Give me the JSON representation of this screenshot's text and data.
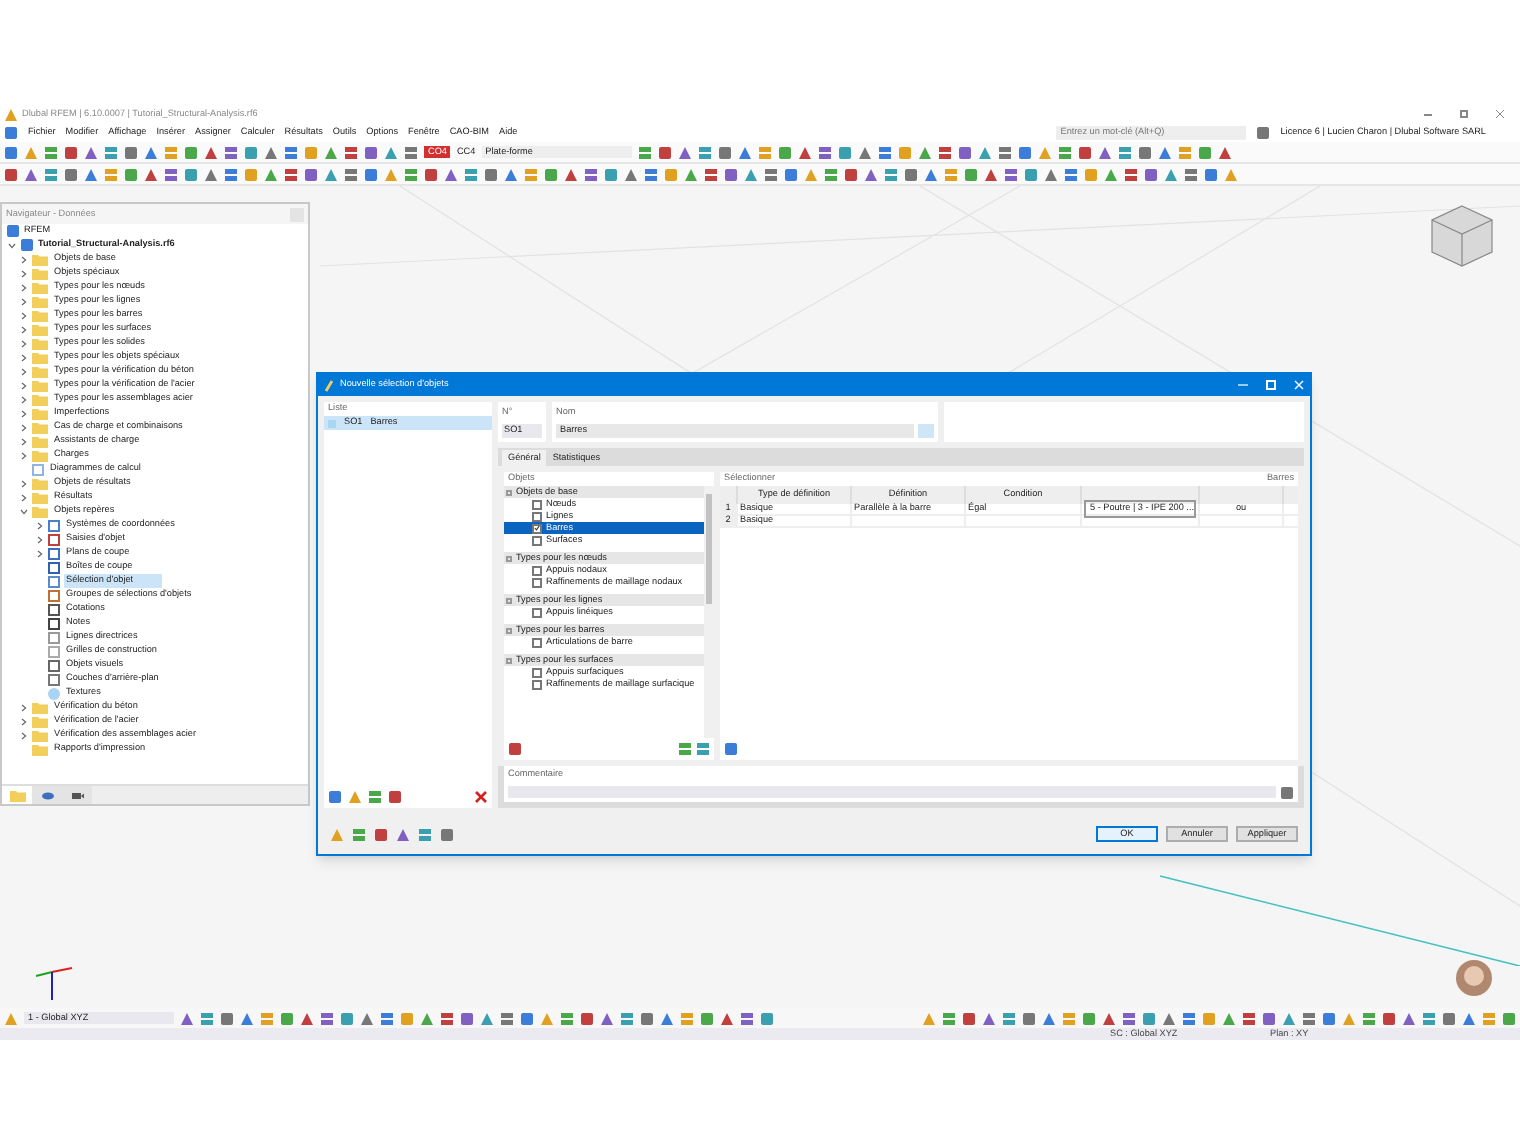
{
  "window": {
    "title": "Dlubal RFEM | 6.10.0007 | Tutorial_Structural-Analysis.rf6"
  },
  "menu": [
    "Fichier",
    "Modifier",
    "Affichage",
    "Insérer",
    "Assigner",
    "Calculer",
    "Résultats",
    "Outils",
    "Options",
    "Fenêtre",
    "CAO-BIM",
    "Aide"
  ],
  "toolbar": {
    "load_badge": "CO4",
    "load_case": "CC4",
    "design_situation": "Plate-forme",
    "search": {
      "placeholder": "Entrez un mot-clé (Alt+Q)"
    },
    "license": "Licence 6 | Lucien Charon | Dlubal Software SARL"
  },
  "navigator": {
    "title": "Navigateur - Données",
    "root": "RFEM",
    "file": "Tutorial_Structural-Analysis.rf6",
    "items": [
      {
        "label": "Objets de base",
        "kind": "folder",
        "expanded": false,
        "selected": false
      },
      {
        "label": "Objets spéciaux",
        "kind": "folder",
        "expanded": false,
        "selected": false
      },
      {
        "label": "Types pour les nœuds",
        "kind": "folder",
        "expanded": false,
        "selected": false
      },
      {
        "label": "Types pour les lignes",
        "kind": "folder",
        "expanded": false,
        "selected": false
      },
      {
        "label": "Types pour les barres",
        "kind": "folder",
        "expanded": false,
        "selected": false
      },
      {
        "label": "Types pour les surfaces",
        "kind": "folder",
        "expanded": false,
        "selected": false
      },
      {
        "label": "Types pour les solides",
        "kind": "folder",
        "expanded": false,
        "selected": false
      },
      {
        "label": "Types pour les objets spéciaux",
        "kind": "folder",
        "expanded": false,
        "selected": false
      },
      {
        "label": "Types pour la vérification du béton",
        "kind": "folder",
        "expanded": false,
        "selected": false
      },
      {
        "label": "Types pour la vérification de l'acier",
        "kind": "folder",
        "expanded": false,
        "selected": false
      },
      {
        "label": "Types pour les assemblages acier",
        "kind": "folder",
        "expanded": false,
        "selected": false
      },
      {
        "label": "Imperfections",
        "kind": "folder",
        "expanded": false,
        "selected": false
      },
      {
        "label": "Cas de charge et combinaisons",
        "kind": "folder",
        "expanded": false,
        "selected": false
      },
      {
        "label": "Assistants de charge",
        "kind": "folder",
        "expanded": false,
        "selected": false
      },
      {
        "label": "Charges",
        "kind": "folder",
        "expanded": false,
        "selected": false
      },
      {
        "label": "Diagrammes de calcul",
        "kind": "chart",
        "selected": false
      },
      {
        "label": "Objets de résultats",
        "kind": "folder",
        "expanded": false,
        "selected": false
      },
      {
        "label": "Résultats",
        "kind": "folder",
        "expanded": false,
        "selected": false
      },
      {
        "label": "Objets repères",
        "kind": "folder",
        "expanded": true,
        "selected": false,
        "children": [
          {
            "label": "Systèmes de coordonnées",
            "kind": "axes",
            "expanded": false,
            "selected": false
          },
          {
            "label": "Saisies d'objet",
            "kind": "magnet",
            "expanded": false,
            "selected": false
          },
          {
            "label": "Plans de coupe",
            "kind": "plane",
            "expanded": false,
            "selected": false
          },
          {
            "label": "Boîtes de coupe",
            "kind": "box",
            "selected": false
          },
          {
            "label": "Sélection d'objet",
            "kind": "selection",
            "selected": true
          },
          {
            "label": "Groupes de sélections d'objets",
            "kind": "group",
            "selected": false
          },
          {
            "label": "Cotations",
            "kind": "dimension",
            "selected": false
          },
          {
            "label": "Notes",
            "kind": "note",
            "selected": false
          },
          {
            "label": "Lignes directrices",
            "kind": "guide",
            "selected": false
          },
          {
            "label": "Grilles de construction",
            "kind": "grid",
            "selected": false
          },
          {
            "label": "Objets visuels",
            "kind": "visual",
            "selected": false
          },
          {
            "label": "Couches d'arrière-plan",
            "kind": "layer",
            "selected": false
          },
          {
            "label": "Textures",
            "kind": "texture",
            "selected": false
          }
        ]
      },
      {
        "label": "Vérification du béton",
        "kind": "folder",
        "expanded": false,
        "selected": false
      },
      {
        "label": "Vérification de l'acier",
        "kind": "folder",
        "expanded": false,
        "selected": false
      },
      {
        "label": "Vérification des assemblages acier",
        "kind": "folder",
        "expanded": false,
        "selected": false
      },
      {
        "label": "Rapports d'impression",
        "kind": "folder",
        "selected": false
      }
    ],
    "tabs": [
      {
        "kind": "data",
        "selected": true
      },
      {
        "kind": "view",
        "selected": false
      },
      {
        "kind": "camera",
        "selected": false
      }
    ]
  },
  "dialog": {
    "title": "Nouvelle sélection d'objets",
    "list": {
      "label": "Liste",
      "items": [
        {
          "number": "SO1",
          "name": "Barres",
          "selected": true
        }
      ]
    },
    "number": {
      "label": "N°",
      "value": "SO1"
    },
    "name": {
      "label": "Nom",
      "value": "Barres"
    },
    "tabs": [
      {
        "label": "Général",
        "selected": true
      },
      {
        "label": "Statistiques",
        "selected": false
      }
    ],
    "objects": {
      "label": "Objets",
      "groups": [
        {
          "title": "Objets de base",
          "items": [
            {
              "label": "Nœuds",
              "checked": false,
              "selected": false
            },
            {
              "label": "Lignes",
              "checked": false,
              "selected": false
            },
            {
              "label": "Barres",
              "checked": true,
              "selected": true
            },
            {
              "label": "Surfaces",
              "checked": false,
              "selected": false
            }
          ]
        },
        {
          "title": "Types pour les nœuds",
          "items": [
            {
              "label": "Appuis nodaux",
              "checked": false,
              "selected": false
            },
            {
              "label": "Raffinements de maillage nodaux",
              "checked": false,
              "selected": false
            }
          ]
        },
        {
          "title": "Types pour les lignes",
          "items": [
            {
              "label": "Appuis linéiques",
              "checked": false,
              "selected": false
            }
          ]
        },
        {
          "title": "Types pour les barres",
          "items": [
            {
              "label": "Articulations de barre",
              "checked": false,
              "selected": false
            }
          ]
        },
        {
          "title": "Types pour les surfaces",
          "items": [
            {
              "label": "Appuis surfaciques",
              "checked": false,
              "selected": false
            },
            {
              "label": "Raffinements de maillage surfacique",
              "checked": false,
              "selected": false
            }
          ]
        }
      ]
    },
    "select": {
      "label": "Sélectionner",
      "target": "Barres",
      "columns": [
        "Type de définition",
        "Définition",
        "Condition"
      ],
      "rows": [
        {
          "number": "1",
          "type": "Basique",
          "definition": "Parallèle à la barre",
          "condition": "Égal",
          "value": "5 - Poutre | 3 - IPE 200 ...",
          "logic": "ou"
        },
        {
          "number": "2",
          "type": "Basique"
        }
      ]
    },
    "comment": {
      "label": "Commentaire"
    },
    "buttons": [
      {
        "label": "OK",
        "kind": "default"
      },
      {
        "label": "Annuler",
        "kind": "normal"
      },
      {
        "label": "Appliquer",
        "kind": "normal"
      }
    ]
  },
  "bottom": {
    "coordinate_system": "1 - Global XYZ"
  },
  "status": {
    "system": "SC : Global XYZ",
    "plane": "Plan : XY"
  }
}
